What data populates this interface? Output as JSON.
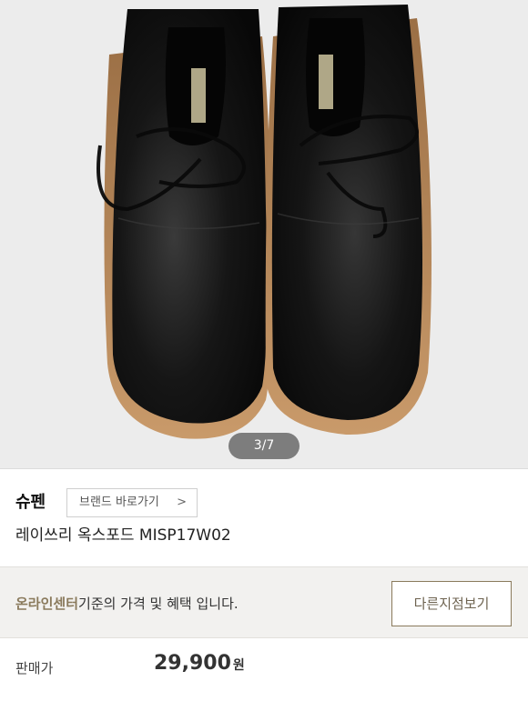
{
  "gallery": {
    "pager": "3/7",
    "colors": {
      "background": "#ececec",
      "shoe": "#111111",
      "sole": "#b88a5c"
    }
  },
  "product": {
    "brand": "슈펜",
    "brand_link_label": "브랜드 바로가기",
    "brand_link_icon": "chevron-right-icon",
    "name": "레이쓰리 옥스포드 MISP17W02"
  },
  "notice": {
    "accent_text": "온라인센터",
    "text": "기준의 가격 및 혜택 입니다.",
    "accent_color": "#8a7a5c",
    "button_label": "다른지점보기"
  },
  "price": {
    "label": "판매가",
    "value": "29,900",
    "unit": "원"
  }
}
